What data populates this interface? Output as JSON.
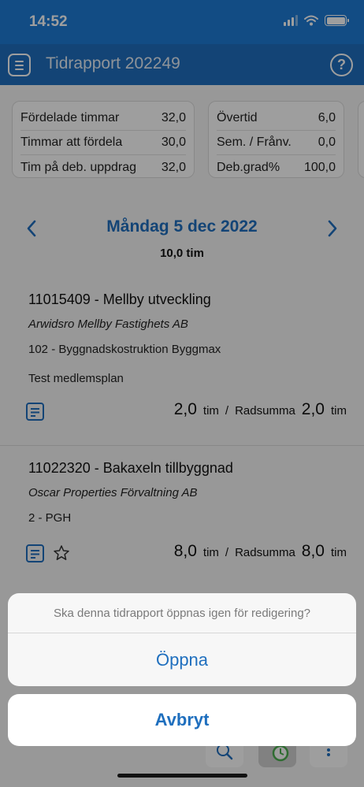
{
  "status_bar": {
    "time": "14:52"
  },
  "header": {
    "title": "Tidrapport 202249",
    "help_label": "?"
  },
  "summary": {
    "left_rows": [
      {
        "label": "Fördelade timmar",
        "value": "32,0"
      },
      {
        "label": "Timmar att fördela",
        "value": "30,0"
      },
      {
        "label": "Tim på deb. uppdrag",
        "value": "32,0"
      }
    ],
    "right_rows": [
      {
        "label": "Övertid",
        "value": "6,0"
      },
      {
        "label": "Sem. / Frånv.",
        "value": "0,0"
      },
      {
        "label": "Deb.grad%",
        "value": "100,0"
      }
    ]
  },
  "day": {
    "title": "Måndag 5 dec 2022",
    "total": "10,0 tim"
  },
  "entries": [
    {
      "project": "11015409 - Mellby utveckling",
      "customer": "Arwidsro Mellby Fastighets AB",
      "activity": "102 - Byggnadskostruktion Byggmax",
      "note": "Test medlemsplan",
      "hours": "2,0",
      "unit": "tim",
      "separator": "/",
      "row_sum_label": "Radsumma",
      "row_sum": "2,0",
      "row_sum_unit": "tim"
    },
    {
      "project": "11022320 - Bakaxeln tillbyggnad",
      "customer": "Oscar Properties Förvaltning AB",
      "activity": "2 - PGH",
      "hours": "8,0",
      "unit": "tim",
      "separator": "/",
      "row_sum_label": "Radsumma",
      "row_sum": "8,0",
      "row_sum_unit": "tim"
    }
  ],
  "action_sheet": {
    "message": "Ska denna tidrapport öppnas igen för redigering?",
    "open_label": "Öppna",
    "cancel_label": "Avbryt"
  },
  "colors": {
    "primary": "#1f6fbe",
    "status_bar": "#1e7bd6"
  }
}
